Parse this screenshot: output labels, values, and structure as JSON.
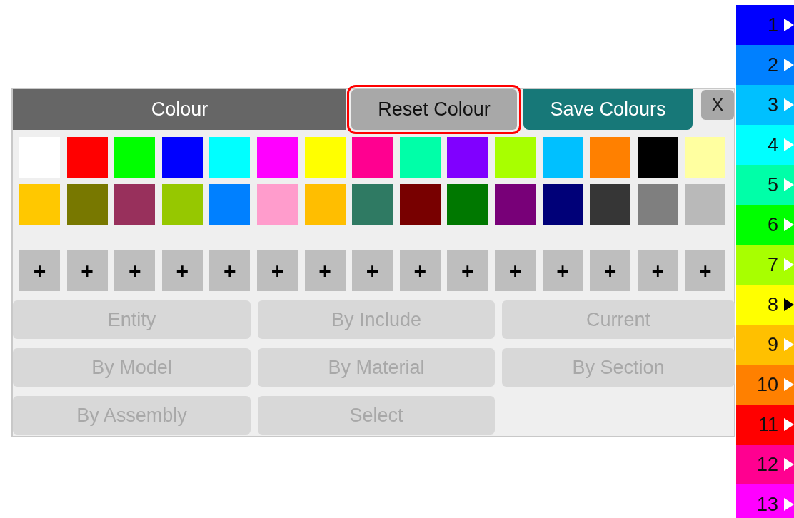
{
  "panel": {
    "title": "Colour",
    "reset_button": {
      "label": "Reset Colour",
      "highlighted": true
    },
    "save_button": {
      "label": "Save Colours"
    },
    "close_button": {
      "label": "X"
    },
    "swatches": [
      {
        "color": "#ffffff"
      },
      {
        "color": "#ff0000"
      },
      {
        "color": "#00ff00"
      },
      {
        "color": "#0000ff"
      },
      {
        "color": "#00ffff"
      },
      {
        "color": "#ff00ff"
      },
      {
        "color": "#ffff00"
      },
      {
        "color": "#ff0090"
      },
      {
        "color": "#00ffa8"
      },
      {
        "color": "#8000ff"
      },
      {
        "color": "#a8ff00"
      },
      {
        "color": "#00c0ff"
      },
      {
        "color": "#ff8000"
      },
      {
        "color": "#000000"
      },
      {
        "color": "#ffffa0"
      },
      {
        "color": "#ffc800"
      },
      {
        "color": "#787800"
      },
      {
        "color": "#98305c"
      },
      {
        "color": "#96c800"
      },
      {
        "color": "#0080ff"
      },
      {
        "color": "#ff9ccc"
      },
      {
        "color": "#ffbe00"
      },
      {
        "color": "#2f7a63"
      },
      {
        "color": "#780000"
      },
      {
        "color": "#007800"
      },
      {
        "color": "#780078"
      },
      {
        "color": "#000078"
      },
      {
        "color": "#363636"
      },
      {
        "color": "#7f7f7f"
      },
      {
        "color": "#b9b9b9"
      }
    ],
    "add_buttons": [
      "+",
      "+",
      "+",
      "+",
      "+",
      "+",
      "+",
      "+",
      "+",
      "+",
      "+",
      "+",
      "+",
      "+",
      "+"
    ],
    "mode_buttons": [
      {
        "label": "Entity",
        "disabled": true
      },
      {
        "label": "By Include",
        "disabled": true
      },
      {
        "label": "Current",
        "disabled": true
      },
      {
        "label": "By Model",
        "disabled": true
      },
      {
        "label": "By Material",
        "disabled": true
      },
      {
        "label": "By Section",
        "disabled": true
      },
      {
        "label": "By Assembly",
        "disabled": true
      },
      {
        "label": "Select",
        "disabled": true
      }
    ]
  },
  "levels": [
    {
      "label": "1",
      "color": "#0000ff",
      "selected": false
    },
    {
      "label": "2",
      "color": "#0080ff",
      "selected": false
    },
    {
      "label": "3",
      "color": "#00c0ff",
      "selected": false
    },
    {
      "label": "4",
      "color": "#00ffff",
      "selected": false
    },
    {
      "label": "5",
      "color": "#00ffa8",
      "selected": false
    },
    {
      "label": "6",
      "color": "#00ff00",
      "selected": false
    },
    {
      "label": "7",
      "color": "#a8ff00",
      "selected": false
    },
    {
      "label": "8",
      "color": "#ffff00",
      "selected": true
    },
    {
      "label": "9",
      "color": "#ffc000",
      "selected": false
    },
    {
      "label": "10",
      "color": "#ff8000",
      "selected": false
    },
    {
      "label": "11",
      "color": "#ff0000",
      "selected": false
    },
    {
      "label": "12",
      "color": "#ff0090",
      "selected": false
    },
    {
      "label": "13",
      "color": "#ff00ff",
      "selected": false
    }
  ]
}
